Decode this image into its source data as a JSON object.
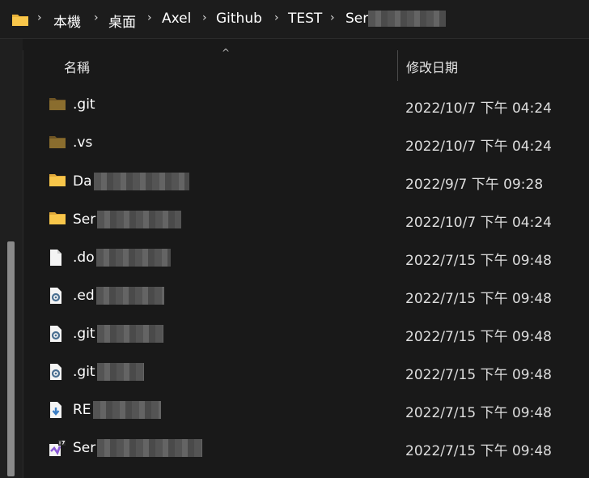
{
  "breadcrumb": {
    "items": [
      "本機",
      "桌面",
      "Axel",
      "Github",
      "TEST",
      "Ser"
    ],
    "separator": "›"
  },
  "columns": {
    "name": "名稱",
    "date": "修改日期"
  },
  "files": [
    {
      "name": ".git",
      "date": "2022/10/7 下午 04:24",
      "icon": "dark-folder-icon"
    },
    {
      "name": ".vs",
      "date": "2022/10/7 下午 04:24",
      "icon": "dark-folder-icon"
    },
    {
      "name": "Da",
      "date": "2022/9/7 下午 09:28",
      "icon": "folder-icon"
    },
    {
      "name": "Ser",
      "date": "2022/10/7 下午 04:24",
      "icon": "folder-icon"
    },
    {
      "name": ".do",
      "date": "2022/7/15 下午 09:48",
      "icon": "file-icon"
    },
    {
      "name": ".ed",
      "date": "2022/7/15 下午 09:48",
      "icon": "settings-file-icon"
    },
    {
      "name": ".git",
      "date": "2022/7/15 下午 09:48",
      "icon": "settings-file-icon"
    },
    {
      "name": ".git",
      "date": "2022/7/15 下午 09:48",
      "icon": "settings-file-icon"
    },
    {
      "name": "RE",
      "date": "2022/7/15 下午 09:48",
      "icon": "download-file-icon"
    },
    {
      "name": "Ser",
      "date": "2022/7/15 下午 09:48",
      "icon": "visual-studio-solution-icon"
    }
  ],
  "colors": {
    "background": "#191919",
    "folder_yellow": "#f8c64a",
    "folder_dark": "#8a6d2e"
  }
}
